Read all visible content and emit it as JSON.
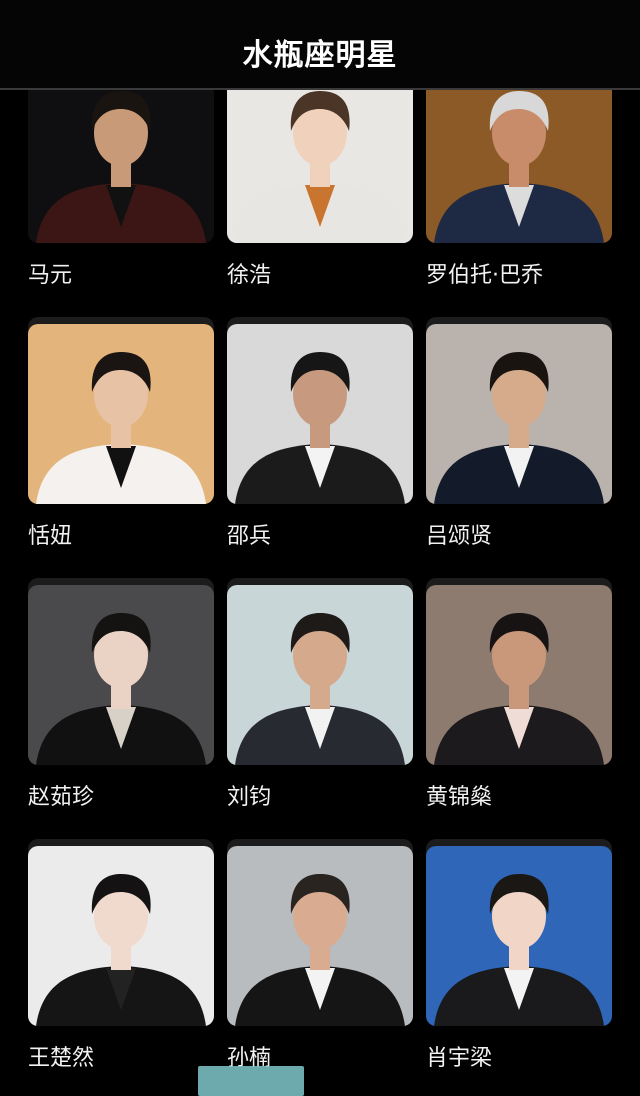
{
  "header": {
    "title": "水瓶座明星"
  },
  "celebrities": [
    {
      "name": "马元",
      "bg": "#0f0f12",
      "skin": "#c99a78",
      "hair": "#1a1410",
      "top": "#3b1614",
      "inner": "#111111"
    },
    {
      "name": "徐浩",
      "bg": "#e9e7e4",
      "skin": "#f0d2bc",
      "hair": "#4a3526",
      "top": "#e8e6e2",
      "inner": "#c9742f"
    },
    {
      "name": "罗伯托·巴乔",
      "bg": "#8c5a26",
      "skin": "#c98c6a",
      "hair": "#d8d8d8",
      "top": "#1e2a44",
      "inner": "#dcdcdc"
    },
    {
      "name": "恬妞",
      "bg": "#e3b57c",
      "skin": "#e8c2a4",
      "hair": "#1a1412",
      "top": "#f4f1ee",
      "inner": "#111111"
    },
    {
      "name": "邵兵",
      "bg": "#d9d9d9",
      "skin": "#c79a7f",
      "hair": "#161616",
      "top": "#1b1b1b",
      "inner": "#f3f3f3"
    },
    {
      "name": "吕颂贤",
      "bg": "#b9b2ad",
      "skin": "#d6ab8c",
      "hair": "#1a1410",
      "top": "#131a2a",
      "inner": "#f2f2f2"
    },
    {
      "name": "赵茹珍",
      "bg": "#4a4a4c",
      "skin": "#ead3c4",
      "hair": "#151212",
      "top": "#111111",
      "inner": "#d7d1c8"
    },
    {
      "name": "刘钧",
      "bg": "#c9d6d8",
      "skin": "#d4a98c",
      "hair": "#1e1a18",
      "top": "#272a30",
      "inner": "#f2f2f2"
    },
    {
      "name": "黄锦燊",
      "bg": "#8e7b70",
      "skin": "#c9987a",
      "hair": "#171313",
      "top": "#1c1a1c",
      "inner": "#f0dcd6"
    },
    {
      "name": "王楚然",
      "bg": "#ecebeb",
      "skin": "#f0d9cd",
      "hair": "#141212",
      "top": "#151515",
      "inner": "#222222"
    },
    {
      "name": "孙楠",
      "bg": "#b8bcbe",
      "skin": "#d9ac92",
      "hair": "#2a2420",
      "top": "#151515",
      "inner": "#f3f3f3"
    },
    {
      "name": "肖宇梁",
      "bg": "#2f66b8",
      "skin": "#f1d6c8",
      "hair": "#1b1715",
      "top": "#1a1a1c",
      "inner": "#f3f3f3"
    }
  ]
}
